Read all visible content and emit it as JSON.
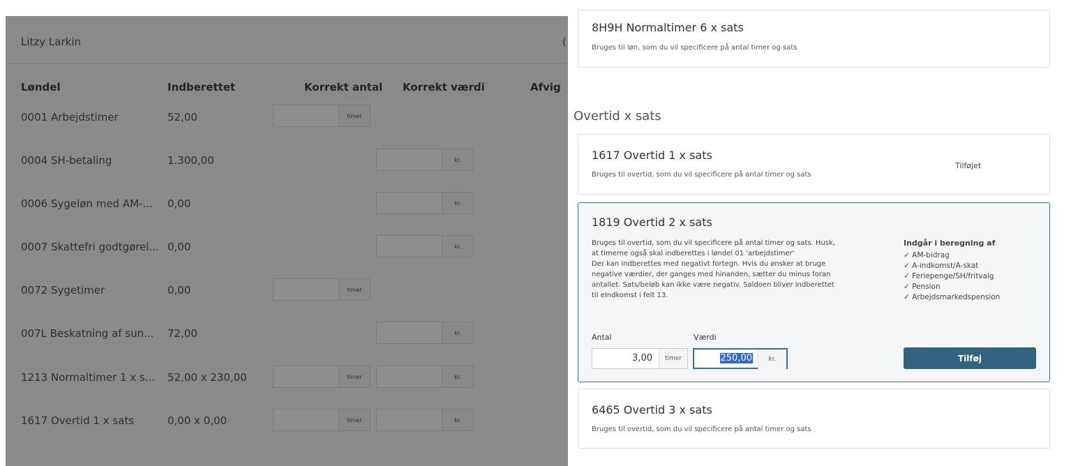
{
  "left": {
    "employee_name": "Litzy Larkin",
    "employee_trunc": "(",
    "columns": [
      "Løndel",
      "Indberettet",
      "Korrekt antal",
      "Korrekt værdi",
      "Afvig"
    ],
    "rows": [
      {
        "name": "0001 Arbejdstimer",
        "value": "52,00",
        "hours_unit": "timer",
        "kr_unit": ""
      },
      {
        "name": "0004 SH-betaling",
        "value": "1.300,00",
        "hours_unit": "",
        "kr_unit": "kr."
      },
      {
        "name": "0006 Sygeløn med AM-...",
        "value": "0,00",
        "hours_unit": "",
        "kr_unit": "kr."
      },
      {
        "name": "0007 Skattefri godtgørel...",
        "value": "0,00",
        "hours_unit": "",
        "kr_unit": "kr."
      },
      {
        "name": "0072 Sygetimer",
        "value": "0,00",
        "hours_unit": "timer",
        "kr_unit": ""
      },
      {
        "name": "007L Beskatning af sun...",
        "value": "72,00",
        "hours_unit": "",
        "kr_unit": "kr."
      },
      {
        "name": "1213 Normaltimer 1 x s...",
        "value": "52,00 x 230,00",
        "hours_unit": "timer",
        "kr_unit": "kr."
      },
      {
        "name": "1617 Overtid 1 x sats",
        "value": "0,00 x 0,00",
        "hours_unit": "timer",
        "kr_unit": "kr."
      }
    ]
  },
  "right": {
    "top_card": {
      "title": "8H9H Normaltimer 6 x sats",
      "desc": "Bruges til løn, som du vil specificere på antal timer og sats"
    },
    "section_title": "Overtid x sats",
    "card_1617": {
      "title": "1617 Overtid 1 x sats",
      "desc": "Bruges til overtid, som du vil specificere på antal timer og sats",
      "status": "Tilføjet"
    },
    "card_1819": {
      "title": "1819 Overtid 2 x sats",
      "desc_lines": [
        "Bruges til overtid, som du vil specificere på antal timer og sats. Husk,",
        "at timerne også skal indberettes i løndel 01 'arbejdstimer'",
        "Der kan indberettes med negativt fortegn. Hvis du ønsker at bruge",
        "negative værdier, der ganges med hinanden, sætter du minus foran",
        "antallet. Sats/beløb kan ikke være negativ. Saldoen bliver indberettet",
        "til eIndkomst i felt 13."
      ],
      "includes_head": "Indgår i beregning af",
      "includes": [
        "✓ AM-bidrag",
        "✓ A-indkomst/A-skat",
        "✓ Feriepenge/SH/fritvalg",
        "✓ Pension",
        "✓ Arbejdsmarkedspension"
      ],
      "antal_label": "Antal",
      "antal_value": "3,00",
      "antal_unit": "timer",
      "vaerdi_label": "Værdi",
      "vaerdi_value": "250,00",
      "vaerdi_unit": "kr.",
      "add_label": "Tilføj"
    },
    "card_6465": {
      "title": "6465 Overtid 3 x sats",
      "desc": "Bruges til overtid, som du vil specificere på antal timer og sats"
    }
  }
}
